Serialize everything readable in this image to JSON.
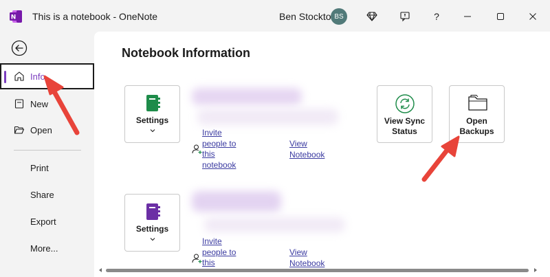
{
  "titlebar": {
    "title": "This is a notebook  -  OneNote",
    "user_name": "Ben Stockton",
    "avatar_initials": "BS",
    "help_label": "?"
  },
  "sidebar": {
    "items": [
      {
        "label": "Info"
      },
      {
        "label": "New"
      },
      {
        "label": "Open"
      },
      {
        "label": "Print"
      },
      {
        "label": "Share"
      },
      {
        "label": "Export"
      },
      {
        "label": "More..."
      }
    ]
  },
  "main": {
    "heading": "Notebook Information",
    "notebooks": [
      {
        "settings_label": "Settings",
        "icon_color": "#1e8c4a",
        "invite_lines": [
          "Invite",
          "people to",
          "this",
          "notebook"
        ],
        "view_lines": [
          "View",
          "Notebook"
        ]
      },
      {
        "settings_label": "Settings",
        "icon_color": "#6b2fa5",
        "invite_lines": [
          "Invite",
          "people to",
          "this"
        ],
        "view_lines": [
          "View",
          "Notebook"
        ]
      }
    ],
    "view_sync_lines": [
      "View Sync",
      "Status"
    ],
    "open_backups_lines": [
      "Open",
      "Backups"
    ]
  },
  "colors": {
    "accent": "#7b3dbf",
    "link": "#3a3aa0",
    "arrow": "#e8443a"
  }
}
